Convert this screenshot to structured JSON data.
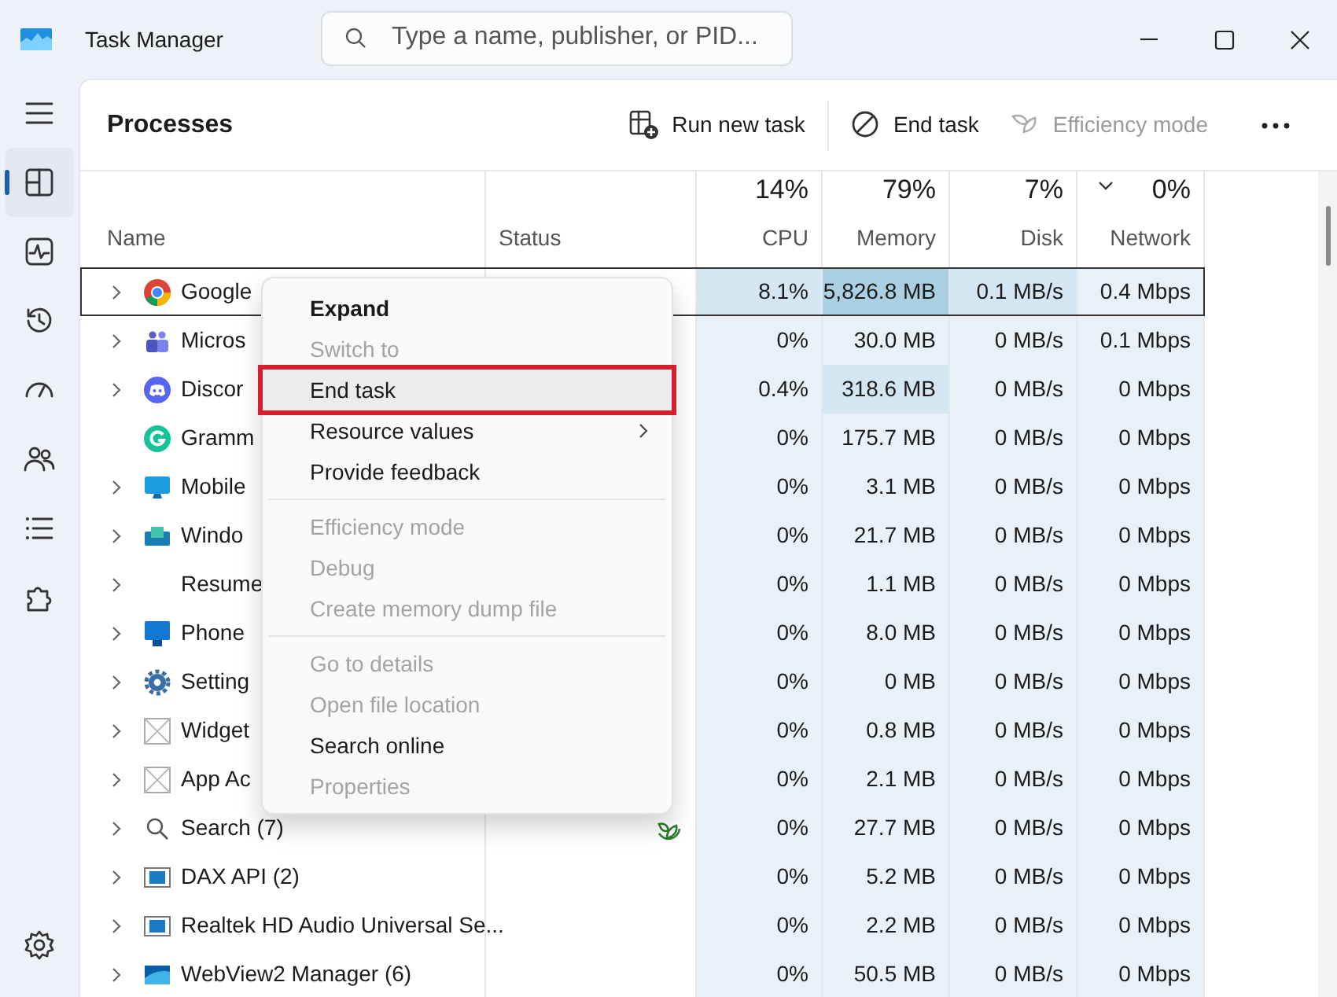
{
  "window": {
    "title": "Task Manager",
    "search_placeholder": "Type a name, publisher, or PID..."
  },
  "nav": [
    {
      "selected": false
    },
    {
      "selected": true
    },
    {
      "selected": false
    },
    {
      "selected": false
    },
    {
      "selected": false
    },
    {
      "selected": false
    },
    {
      "selected": false
    },
    {
      "selected": false
    },
    {
      "selected": false
    }
  ],
  "page_title": "Processes",
  "toolbar": [
    {
      "label": "Run new task",
      "disabled": false
    },
    {
      "label": "End task",
      "disabled": false
    },
    {
      "label": "Efficiency mode",
      "disabled": true
    }
  ],
  "columns": [
    {
      "label": "Name"
    },
    {
      "label": "Status"
    },
    {
      "label": "CPU",
      "total": "14%"
    },
    {
      "label": "Memory",
      "total": "79%"
    },
    {
      "label": "Disk",
      "total": "7%"
    },
    {
      "label": "Network",
      "total": "0%",
      "sorted": true
    }
  ],
  "rows": [
    {
      "name": "Google",
      "expandable": true,
      "selected": true,
      "values": [
        "8.1%",
        "5,826.8 MB",
        "0.1 MB/s",
        "0.4 Mbps"
      ],
      "cell_fills": [
        {
          "color": "#d4e6f1"
        },
        {
          "color": "#aad0e1"
        },
        {
          "color": "#d4e6f1"
        },
        {
          "color": "#e8f1f8"
        }
      ]
    },
    {
      "name": "Micros",
      "expandable": true,
      "selected": false,
      "values": [
        "0%",
        "30.0 MB",
        "0 MB/s",
        "0.1 Mbps"
      ]
    },
    {
      "name": "Discor",
      "expandable": true,
      "selected": false,
      "values": [
        "0.4%",
        "318.6 MB",
        "0 MB/s",
        "0 Mbps"
      ],
      "cell_fills": [
        {
          "color": "#e8f1f8"
        },
        {
          "color": "#d4e6f1"
        },
        {
          "color": "#e8f1f8"
        },
        {
          "color": "#e8f1f8"
        }
      ]
    },
    {
      "name": "Gramm",
      "expandable": false,
      "selected": false,
      "values": [
        "0%",
        "175.7 MB",
        "0 MB/s",
        "0 Mbps"
      ]
    },
    {
      "name": "Mobile",
      "expandable": true,
      "selected": false,
      "values": [
        "0%",
        "3.1 MB",
        "0 MB/s",
        "0 Mbps"
      ]
    },
    {
      "name": "Windo",
      "expandable": true,
      "selected": false,
      "values": [
        "0%",
        "21.7 MB",
        "0 MB/s",
        "0 Mbps"
      ]
    },
    {
      "name": "Resume",
      "expandable": true,
      "selected": false,
      "values": [
        "0%",
        "1.1 MB",
        "0 MB/s",
        "0 Mbps"
      ]
    },
    {
      "name": "Phone",
      "expandable": true,
      "selected": false,
      "values": [
        "0%",
        "8.0 MB",
        "0 MB/s",
        "0 Mbps"
      ]
    },
    {
      "name": "Setting",
      "expandable": true,
      "selected": false,
      "values": [
        "0%",
        "0 MB",
        "0 MB/s",
        "0 Mbps"
      ]
    },
    {
      "name": "Widget",
      "expandable": true,
      "selected": false,
      "values": [
        "0%",
        "0.8 MB",
        "0 MB/s",
        "0 Mbps"
      ]
    },
    {
      "name": "App Ac",
      "expandable": true,
      "selected": false,
      "values": [
        "0%",
        "2.1 MB",
        "0 MB/s",
        "0 Mbps"
      ]
    },
    {
      "name": "Search (7)",
      "expandable": true,
      "selected": false,
      "efficiency": true,
      "values": [
        "0%",
        "27.7 MB",
        "0 MB/s",
        "0 Mbps"
      ]
    },
    {
      "name": "DAX API (2)",
      "expandable": true,
      "selected": false,
      "values": [
        "0%",
        "5.2 MB",
        "0 MB/s",
        "0 Mbps"
      ]
    },
    {
      "name": "Realtek HD Audio Universal Se...",
      "expandable": true,
      "selected": false,
      "values": [
        "0%",
        "2.2 MB",
        "0 MB/s",
        "0 Mbps"
      ]
    },
    {
      "name": "WebView2 Manager (6)",
      "expandable": true,
      "selected": false,
      "values": [
        "0%",
        "50.5 MB",
        "0 MB/s",
        "0 Mbps"
      ]
    }
  ],
  "context_menu": [
    {
      "kind": "item",
      "label": "Expand",
      "disabled": false,
      "highlighted": false
    },
    {
      "kind": "item",
      "label": "Switch to",
      "disabled": true,
      "highlighted": false
    },
    {
      "kind": "item",
      "label": "End task",
      "disabled": false,
      "highlighted": true
    },
    {
      "kind": "item",
      "label": "Resource values",
      "disabled": false,
      "highlighted": false,
      "submenu": true
    },
    {
      "kind": "item",
      "label": "Provide feedback",
      "disabled": false,
      "highlighted": false
    },
    {
      "kind": "divider"
    },
    {
      "kind": "item",
      "label": "Efficiency mode",
      "disabled": true,
      "highlighted": false
    },
    {
      "kind": "item",
      "label": "Debug",
      "disabled": true,
      "highlighted": false
    },
    {
      "kind": "item",
      "label": "Create memory dump file",
      "disabled": true,
      "highlighted": false
    },
    {
      "kind": "divider"
    },
    {
      "kind": "item",
      "label": "Go to details",
      "disabled": true,
      "highlighted": false
    },
    {
      "kind": "item",
      "label": "Open file location",
      "disabled": true,
      "highlighted": false
    },
    {
      "kind": "item",
      "label": "Search online",
      "disabled": false,
      "highlighted": false
    },
    {
      "kind": "item",
      "label": "Properties",
      "disabled": true,
      "highlighted": false
    }
  ]
}
